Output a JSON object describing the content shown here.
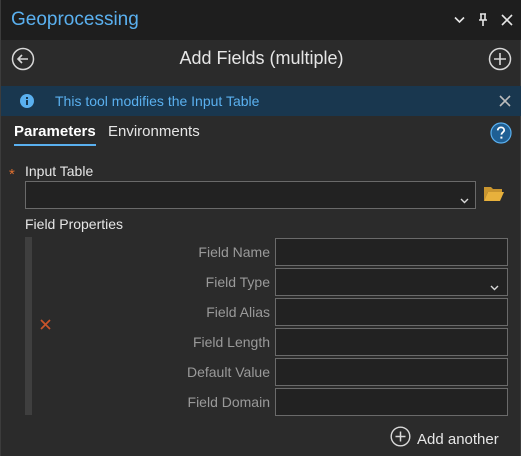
{
  "pane": {
    "title": "Geoprocessing"
  },
  "header": {
    "tool_title": "Add Fields (multiple)"
  },
  "banner": {
    "message": "This tool modifies the Input Table"
  },
  "tabs": [
    {
      "label": "Parameters",
      "active": true
    },
    {
      "label": "Environments",
      "active": false
    }
  ],
  "input_table": {
    "label": "Input Table",
    "required_marker": "*",
    "value": ""
  },
  "field_properties": {
    "label": "Field Properties",
    "rows": [
      {
        "label": "Field Name",
        "value": ""
      },
      {
        "label": "Field Type",
        "value": ""
      },
      {
        "label": "Field Alias",
        "value": ""
      },
      {
        "label": "Field Length",
        "value": ""
      },
      {
        "label": "Default Value",
        "value": ""
      },
      {
        "label": "Field Domain",
        "value": ""
      }
    ]
  },
  "add_another": {
    "label": "Add another"
  },
  "colors": {
    "accent": "#5ab0ef",
    "banner_bg": "#19374f",
    "required": "#e0702f",
    "delete": "#c8542a",
    "folder": "#e8b13c"
  },
  "icons": [
    "chevron-down-icon",
    "pin-icon",
    "close-icon",
    "back-arrow-icon",
    "add-circle-icon",
    "info-icon",
    "help-icon",
    "folder-icon",
    "delete-x-icon"
  ]
}
